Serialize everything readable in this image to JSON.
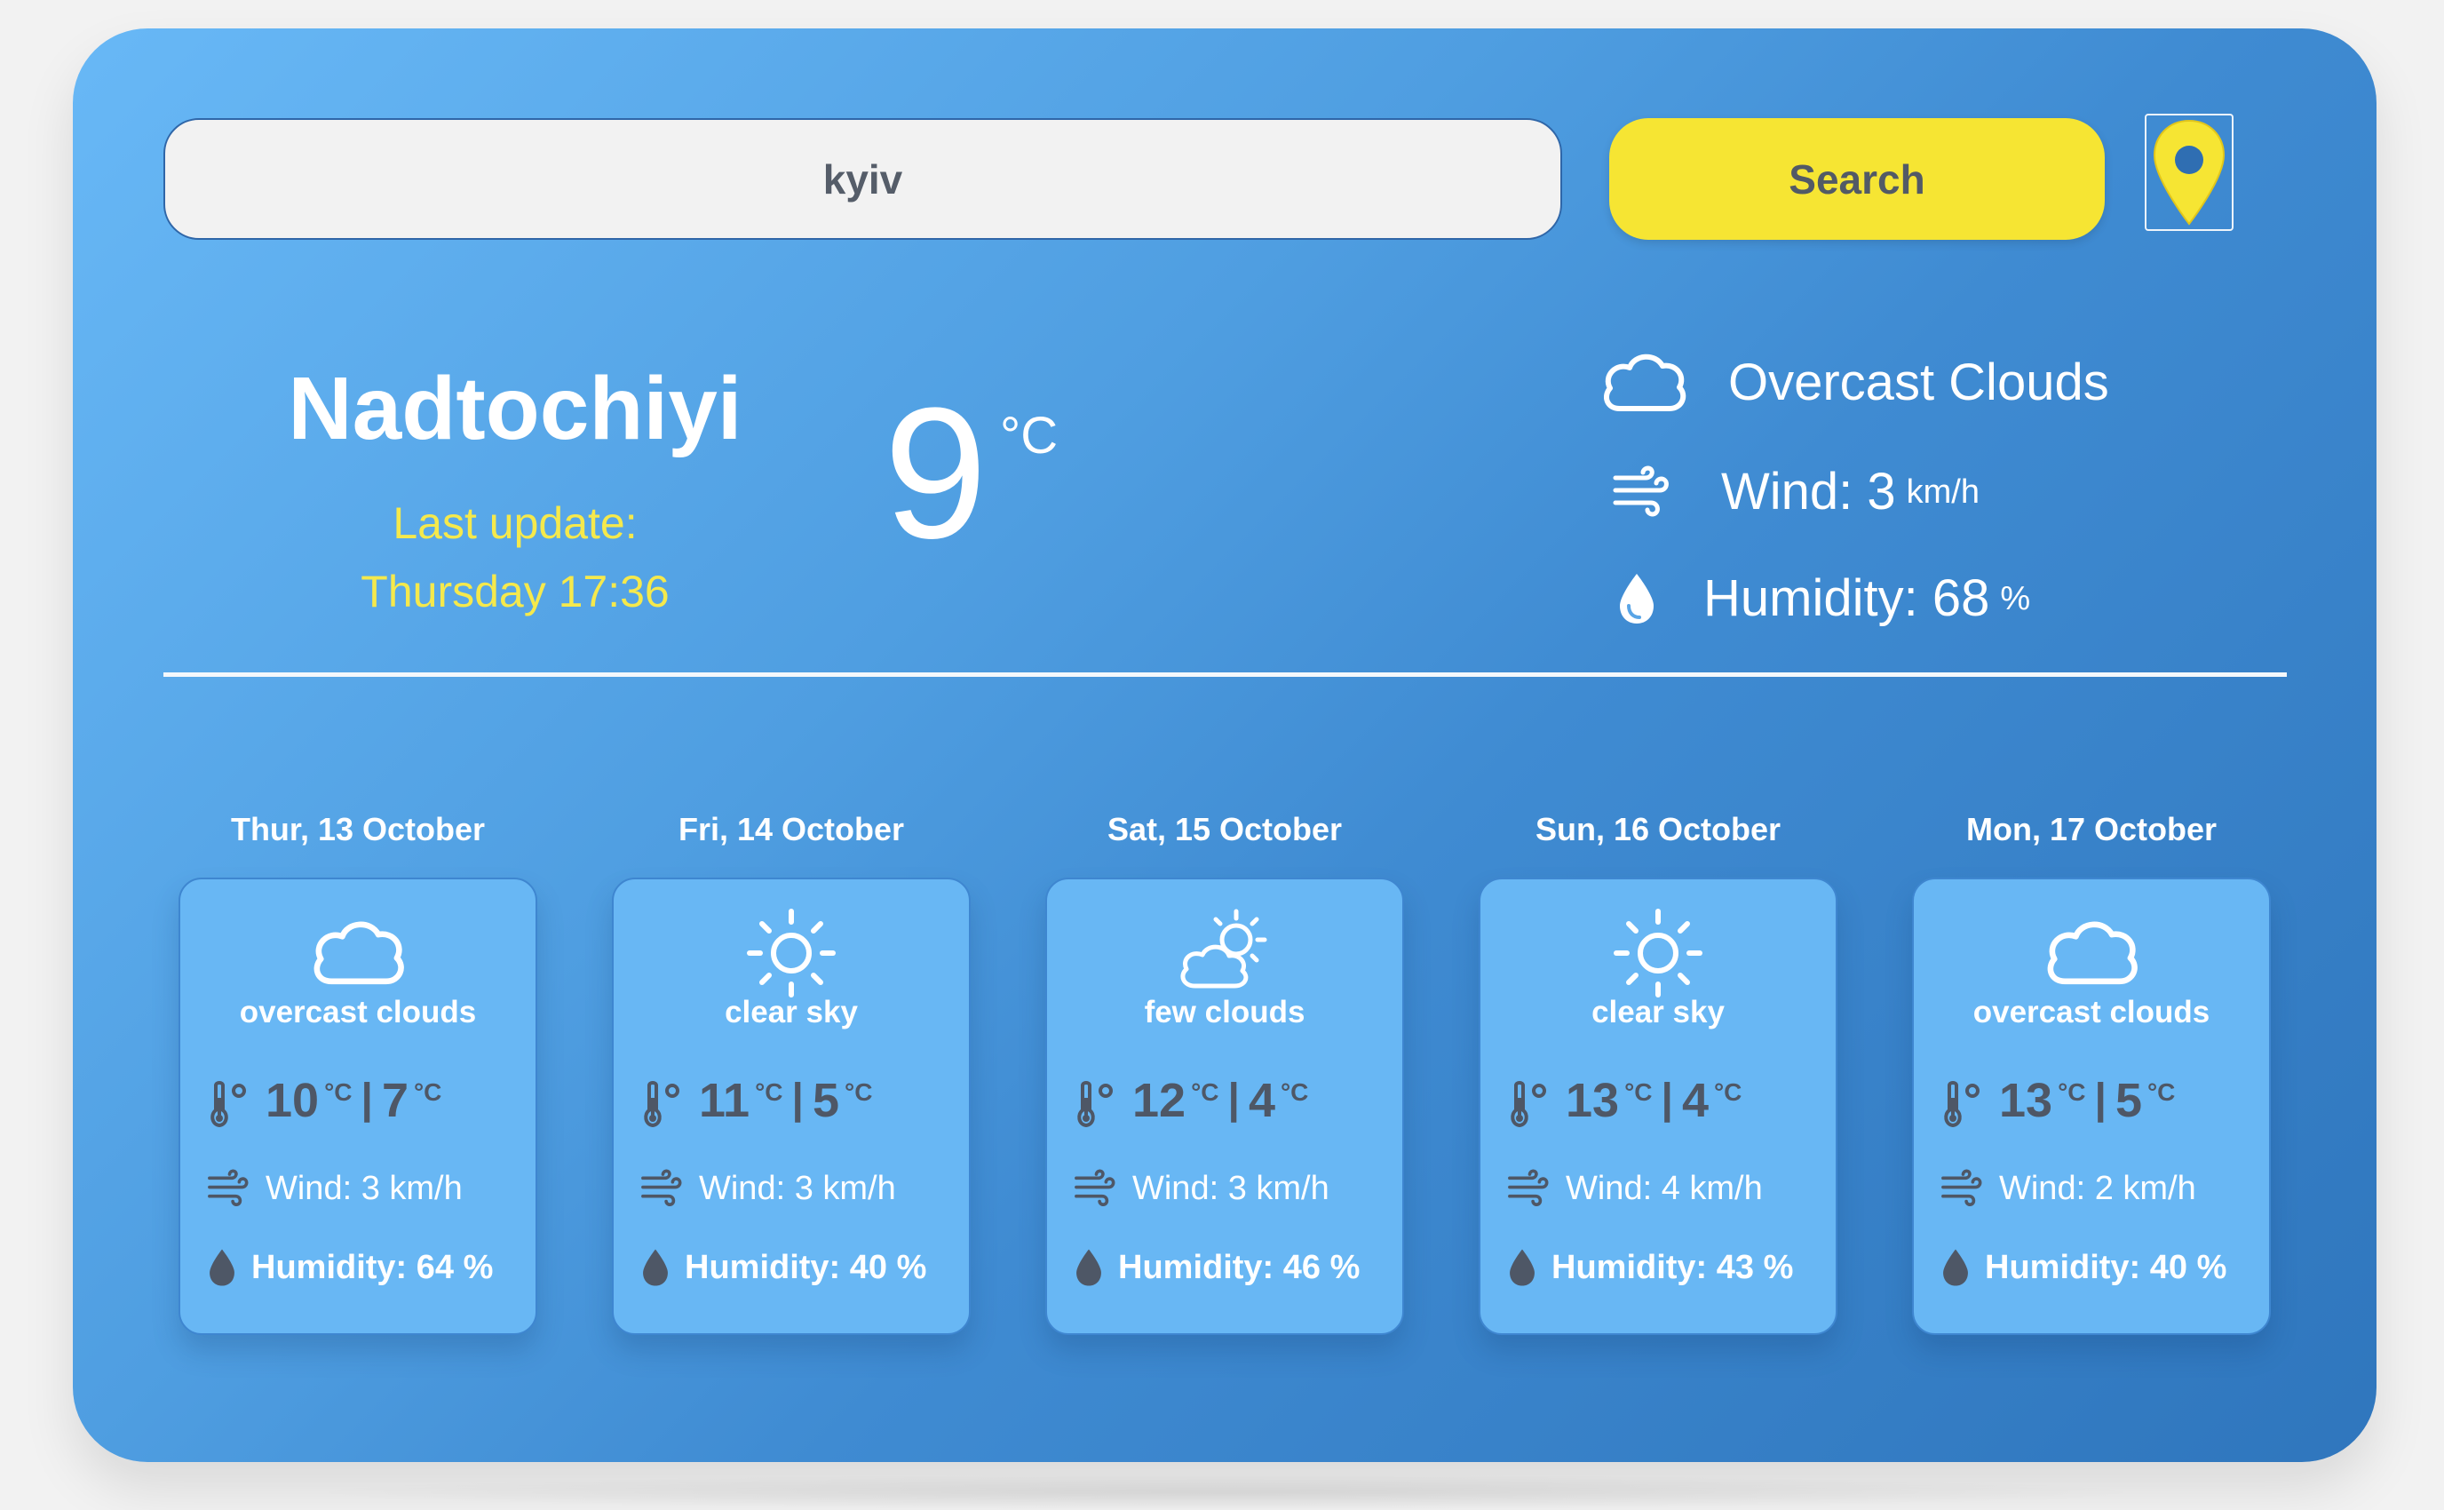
{
  "search": {
    "value": "kyiv",
    "button_label": "Search"
  },
  "colors": {
    "accent_yellow": "#f6e533",
    "card_blue": "#68b7f4",
    "text_dark": "#4e5766"
  },
  "current": {
    "city": "Nadtochiyi",
    "last_update_label": "Last update:",
    "last_update_time": "Thursday 17:36",
    "temperature": "9",
    "temperature_unit": "°C",
    "condition": "Overcast Clouds",
    "condition_icon": "cloud-icon",
    "wind_label": "Wind: 3",
    "wind_unit": "km/h",
    "humidity_label": "Humidity: 68",
    "humidity_unit": "%"
  },
  "forecast": [
    {
      "day": "Thur, 13 October",
      "icon": "cloud-icon",
      "description": "overcast clouds",
      "max": "10",
      "min": "7",
      "unit": "°C",
      "wind": "Wind: 3 km/h",
      "humidity": "Humidity: 64 %"
    },
    {
      "day": "Fri, 14 October",
      "icon": "sun-icon",
      "description": "clear sky",
      "max": "11",
      "min": "5",
      "unit": "°C",
      "wind": "Wind: 3 km/h",
      "humidity": "Humidity: 40 %"
    },
    {
      "day": "Sat, 15 October",
      "icon": "partly-cloudy-icon",
      "description": "few clouds",
      "max": "12",
      "min": "4",
      "unit": "°C",
      "wind": "Wind: 3 km/h",
      "humidity": "Humidity: 46 %"
    },
    {
      "day": "Sun, 16 October",
      "icon": "sun-icon",
      "description": "clear sky",
      "max": "13",
      "min": "4",
      "unit": "°C",
      "wind": "Wind: 4 km/h",
      "humidity": "Humidity: 43 %"
    },
    {
      "day": "Mon, 17 October",
      "icon": "cloud-icon",
      "description": "overcast clouds",
      "max": "13",
      "min": "5",
      "unit": "°C",
      "wind": "Wind: 2 km/h",
      "humidity": "Humidity: 40 %"
    }
  ],
  "separator": "|"
}
